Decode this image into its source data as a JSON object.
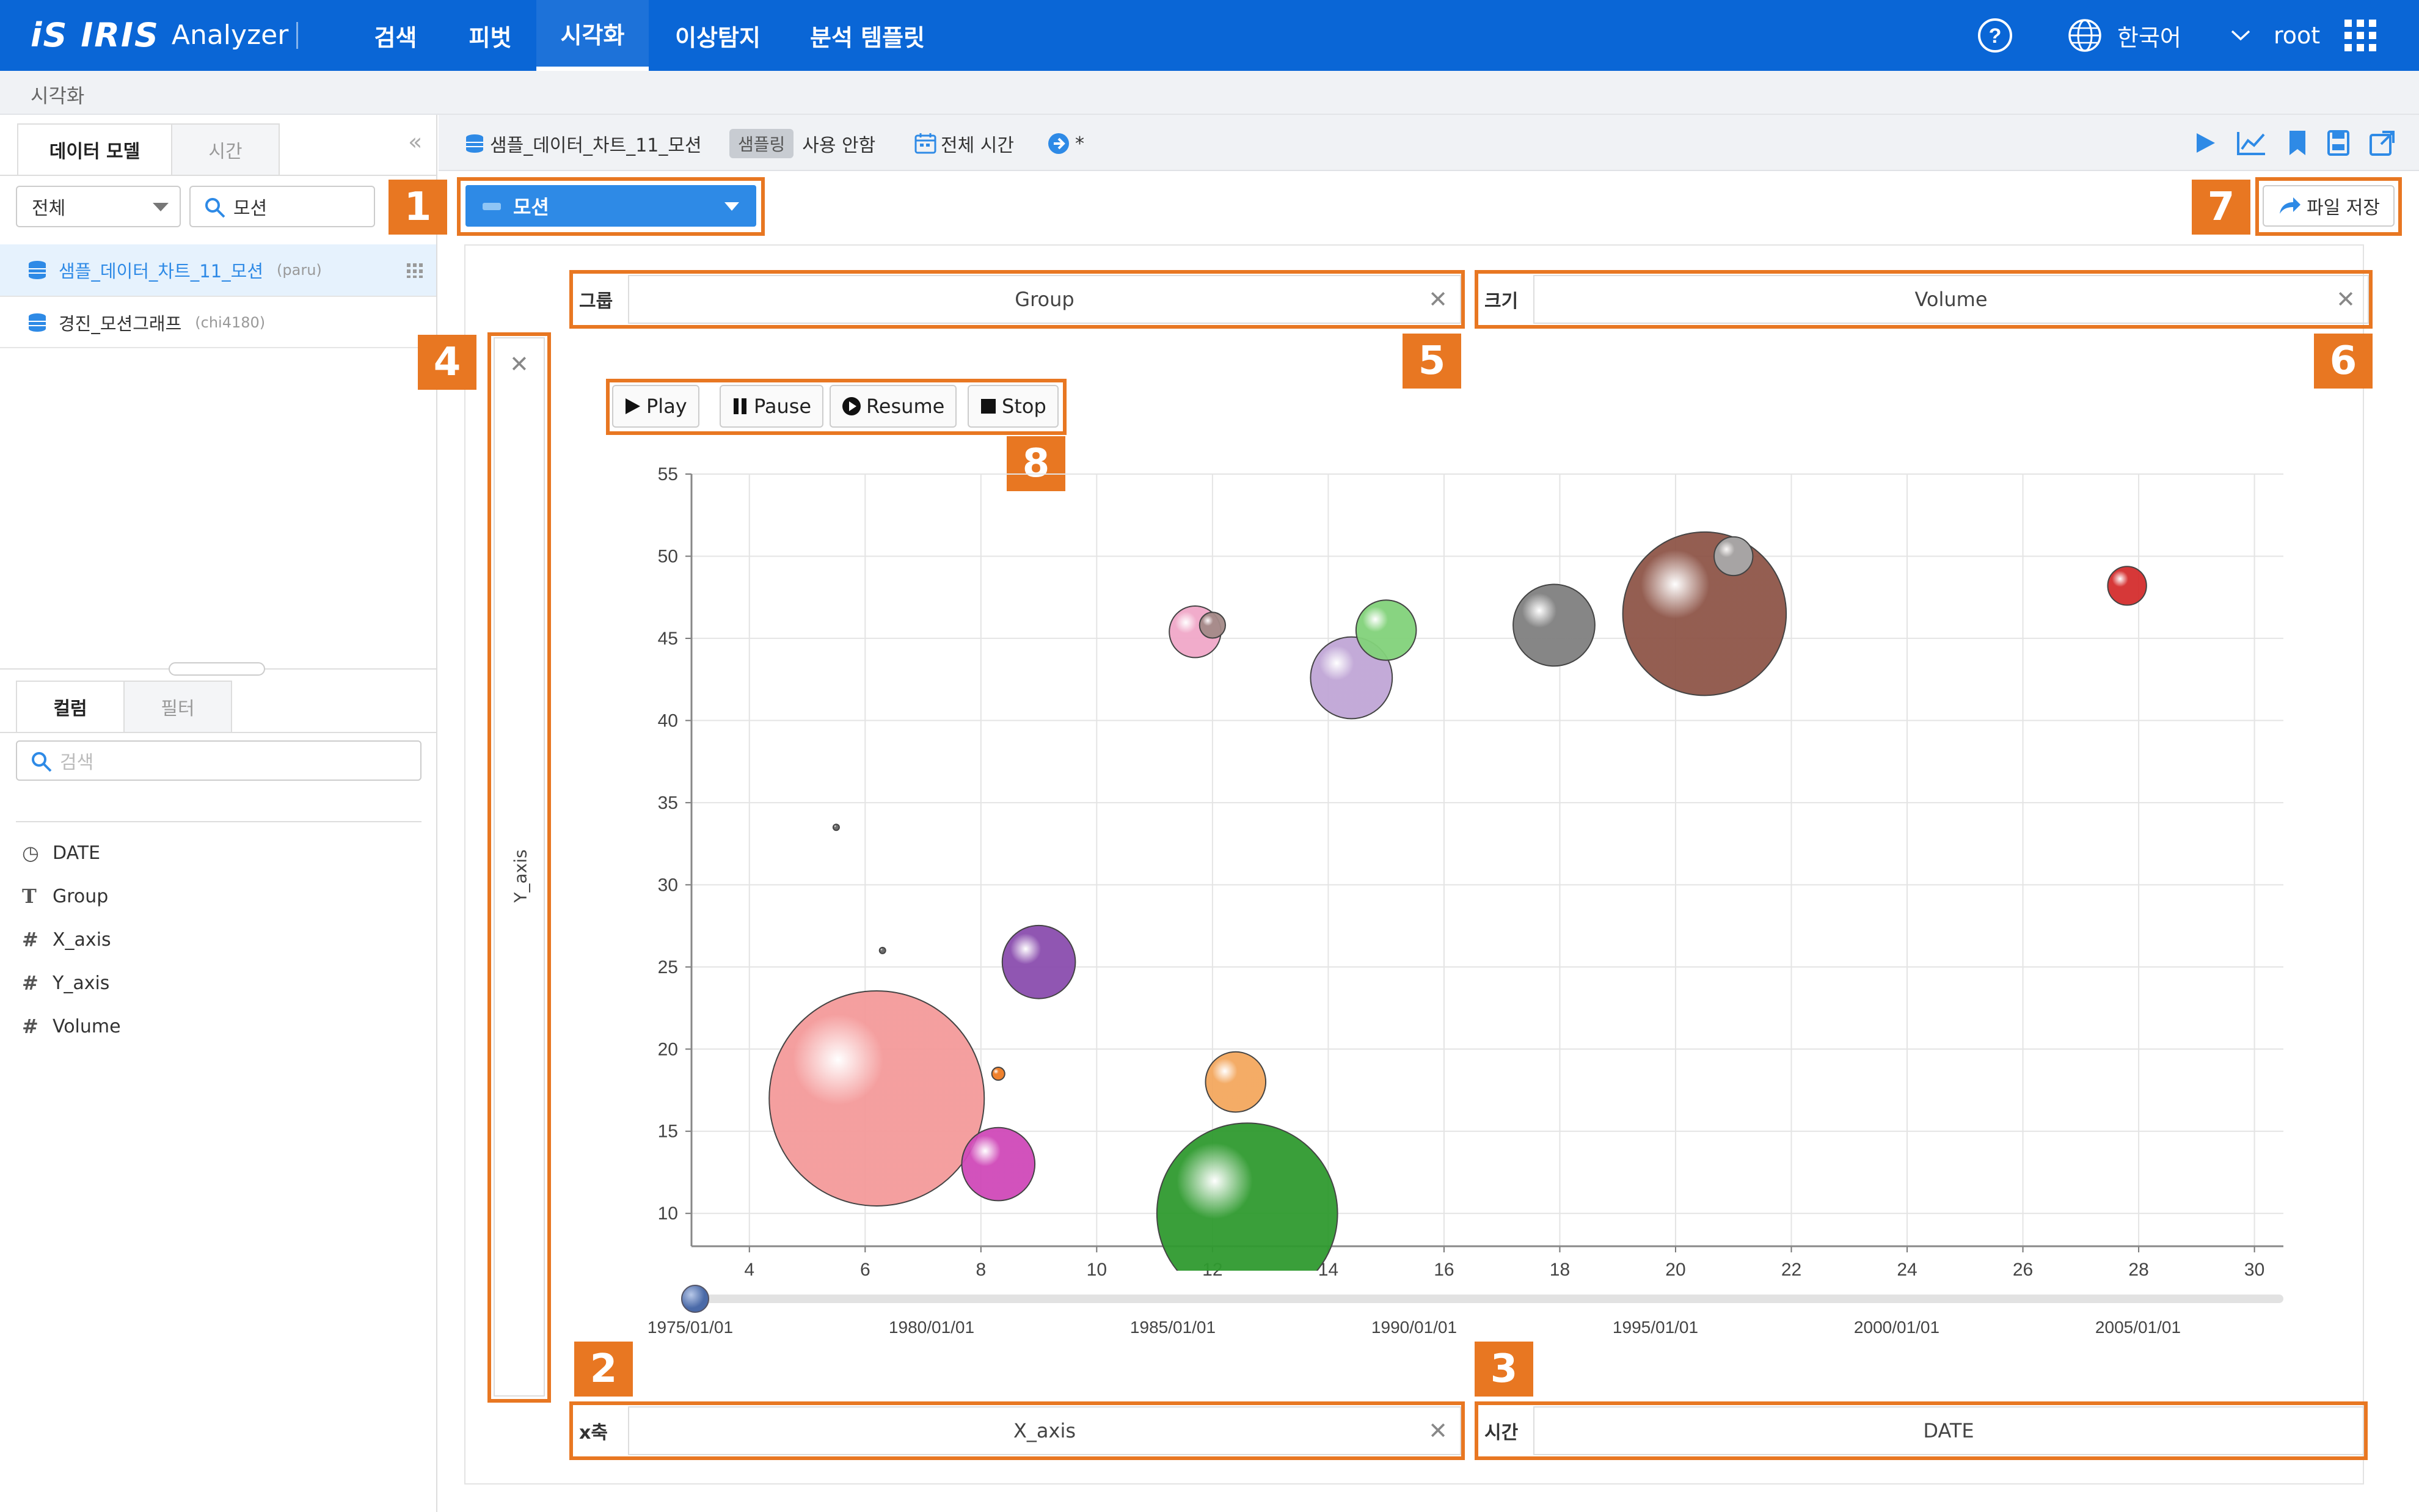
{
  "app": {
    "logo_mark": "iS IRIS",
    "app_name": "Analyzer"
  },
  "nav": {
    "items": [
      "검색",
      "피벗",
      "시각화",
      "이상탐지",
      "분석 템플릿"
    ],
    "active": "시각화"
  },
  "header_right": {
    "language": "한국어",
    "user": "root"
  },
  "breadcrumb": "시각화",
  "sidebar": {
    "tabs": [
      "데이터 모델",
      "시간"
    ],
    "filter_select": "전체",
    "search_value": "모션",
    "datasets": [
      {
        "name": "샘플_데이터_차트_11_모션",
        "owner": "(paru)"
      },
      {
        "name": "경진_모션그래프",
        "owner": "(chi4180)"
      }
    ],
    "column_tabs": [
      "컬럼",
      "필터"
    ],
    "column_search_placeholder": "검색",
    "columns": [
      {
        "icon": "clock-icon",
        "glyph": "◷",
        "name": "DATE"
      },
      {
        "icon": "text-icon",
        "glyph": "T",
        "name": "Group"
      },
      {
        "icon": "number-icon",
        "glyph": "#",
        "name": "X_axis"
      },
      {
        "icon": "number-icon",
        "glyph": "#",
        "name": "Y_axis"
      },
      {
        "icon": "number-icon",
        "glyph": "#",
        "name": "Volume"
      }
    ]
  },
  "toolbar": {
    "dataset": "샘플_데이터_차트_11_모션",
    "sampling_chip": "샘플링",
    "sampling_value": "사용 안함",
    "time_range": "전체 시간",
    "arrow_suffix": "*"
  },
  "chart_type_select": "모션",
  "save_file": "파일 저장",
  "fields": {
    "group_label": "그룹",
    "group_value": "Group",
    "size_label": "크기",
    "size_value": "Volume",
    "yaxis_value": "Y_axis",
    "xaxis_label": "x축",
    "xaxis_value": "X_axis",
    "time_label": "시간",
    "time_value": "DATE"
  },
  "player": {
    "play": "Play",
    "pause": "Pause",
    "resume": "Resume",
    "stop": "Stop"
  },
  "callouts": [
    "1",
    "2",
    "3",
    "4",
    "5",
    "6",
    "7",
    "8"
  ],
  "chart_data": {
    "type": "scatter",
    "subtype": "bubble",
    "xlim": [
      3,
      30.5
    ],
    "ylim": [
      8,
      55
    ],
    "x_ticks": [
      4,
      6,
      8,
      10,
      12,
      14,
      16,
      18,
      20,
      22,
      24,
      26,
      28,
      30
    ],
    "y_ticks": [
      10,
      15,
      20,
      25,
      30,
      35,
      40,
      45,
      50,
      55
    ],
    "grid": true,
    "timeline_labels": [
      "1975/01/01",
      "1980/01/01",
      "1985/01/01",
      "1990/01/01",
      "1995/01/01",
      "2000/01/01",
      "2005/01/01"
    ],
    "timeline_position": 0,
    "bubbles": [
      {
        "x": 6.2,
        "y": 17,
        "r": 1.0,
        "color": "#f49a9a"
      },
      {
        "x": 8.3,
        "y": 13,
        "r": 0.34,
        "color": "#cf49b8"
      },
      {
        "x": 9.0,
        "y": 25.3,
        "r": 0.34,
        "color": "#8a4dae"
      },
      {
        "x": 8.3,
        "y": 18.5,
        "r": 0.06,
        "color": "#ee7a22"
      },
      {
        "x": 5.5,
        "y": 33.5,
        "r": 0.02,
        "color": "#666666"
      },
      {
        "x": 6.3,
        "y": 26,
        "r": 0.02,
        "color": "#666666"
      },
      {
        "x": 12.4,
        "y": 18,
        "r": 0.28,
        "color": "#f3a75e"
      },
      {
        "x": 12.6,
        "y": 10,
        "r": 0.84,
        "color": "#2f9a2f"
      },
      {
        "x": 11.7,
        "y": 45.4,
        "r": 0.24,
        "color": "#f0a8c8"
      },
      {
        "x": 12.0,
        "y": 45.8,
        "r": 0.12,
        "color": "#a48a88"
      },
      {
        "x": 14.4,
        "y": 42.6,
        "r": 0.38,
        "color": "#c0a6d6"
      },
      {
        "x": 15.0,
        "y": 45.5,
        "r": 0.28,
        "color": "#82d27a"
      },
      {
        "x": 17.9,
        "y": 45.8,
        "r": 0.38,
        "color": "#808080"
      },
      {
        "x": 20.5,
        "y": 46.5,
        "r": 0.76,
        "color": "#8e5548"
      },
      {
        "x": 21.0,
        "y": 50,
        "r": 0.18,
        "color": "#a8a8a8"
      },
      {
        "x": 27.8,
        "y": 48.2,
        "r": 0.18,
        "color": "#d42d2d"
      }
    ]
  }
}
